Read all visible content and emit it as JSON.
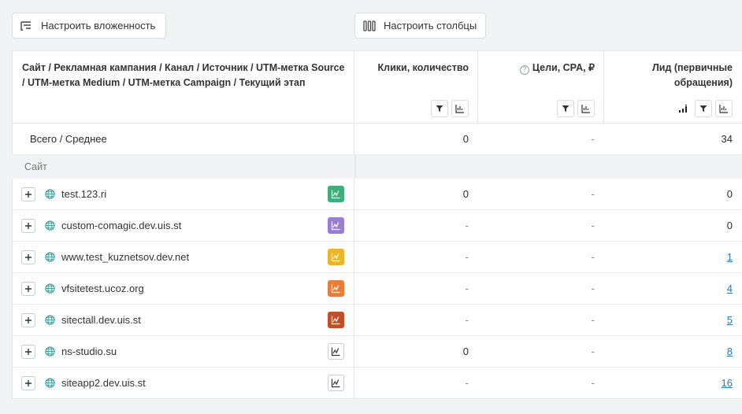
{
  "toolbar": {
    "nesting_label": "Настроить вложенность",
    "columns_label": "Настроить столбцы"
  },
  "header": {
    "dimension": "Сайт / Рекламная кампания / Канал / Источник / UTM-метка Source / UTM-метка Medium / UTM-метка Campaign / Текущий этап",
    "col1": "Клики, количество",
    "col2": "Цели, CPA, ₽",
    "col2_help": "?",
    "col3": "Лид (первичные обращения)"
  },
  "total": {
    "label": "Всего / Среднее",
    "values": [
      "0",
      "-",
      "34"
    ]
  },
  "group": {
    "label": "Сайт"
  },
  "rows": [
    {
      "name": "test.123.ri",
      "clicks": "0",
      "goals": "-",
      "leads": "0",
      "leads_link": false,
      "chart_color": "#3fae7c"
    },
    {
      "name": "custom-comagic.dev.uis.st",
      "clicks": "-",
      "goals": "-",
      "leads": "0",
      "leads_link": false,
      "chart_color": "#9b7fcf"
    },
    {
      "name": "www.test_kuznetsov.dev.net",
      "clicks": "-",
      "goals": "-",
      "leads": "1",
      "leads_link": true,
      "chart_color": "#e8b52b"
    },
    {
      "name": "vfsitetest.ucoz.org",
      "clicks": "-",
      "goals": "-",
      "leads": "4",
      "leads_link": true,
      "chart_color": "#e67e3a"
    },
    {
      "name": "sitectall.dev.uis.st",
      "clicks": "-",
      "goals": "-",
      "leads": "5",
      "leads_link": true,
      "chart_color": "#c0502a"
    },
    {
      "name": "ns-studio.su",
      "clicks": "0",
      "goals": "-",
      "leads": "8",
      "leads_link": true,
      "chart_color": ""
    },
    {
      "name": "siteapp2.dev.uis.st",
      "clicks": "-",
      "goals": "-",
      "leads": "16",
      "leads_link": true,
      "chart_color": ""
    }
  ],
  "colors": {
    "globe": "#3aa3a0",
    "link": "#2a7ab8"
  }
}
